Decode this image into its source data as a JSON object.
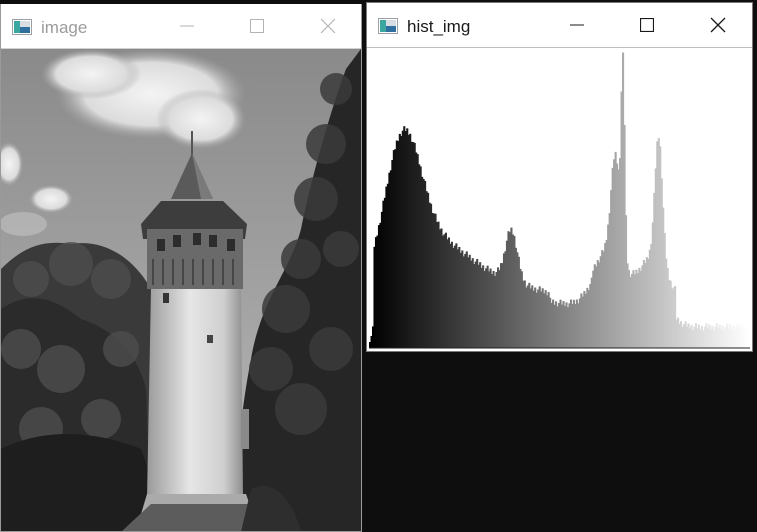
{
  "windows": {
    "image": {
      "title": "image",
      "active": false,
      "controls": [
        "minimize-icon",
        "maximize-icon",
        "close-icon"
      ],
      "content": "grayscale-photo"
    },
    "hist": {
      "title": "hist_img",
      "active": true,
      "controls": [
        "minimize-icon",
        "maximize-icon",
        "close-icon"
      ],
      "content": "grayscale-histogram"
    }
  },
  "colors": {
    "desktop": "#0e0e0e",
    "titlebar": "#ffffff",
    "inactive_title": "#9b9b9b",
    "active_title": "#1a1a1a"
  }
}
